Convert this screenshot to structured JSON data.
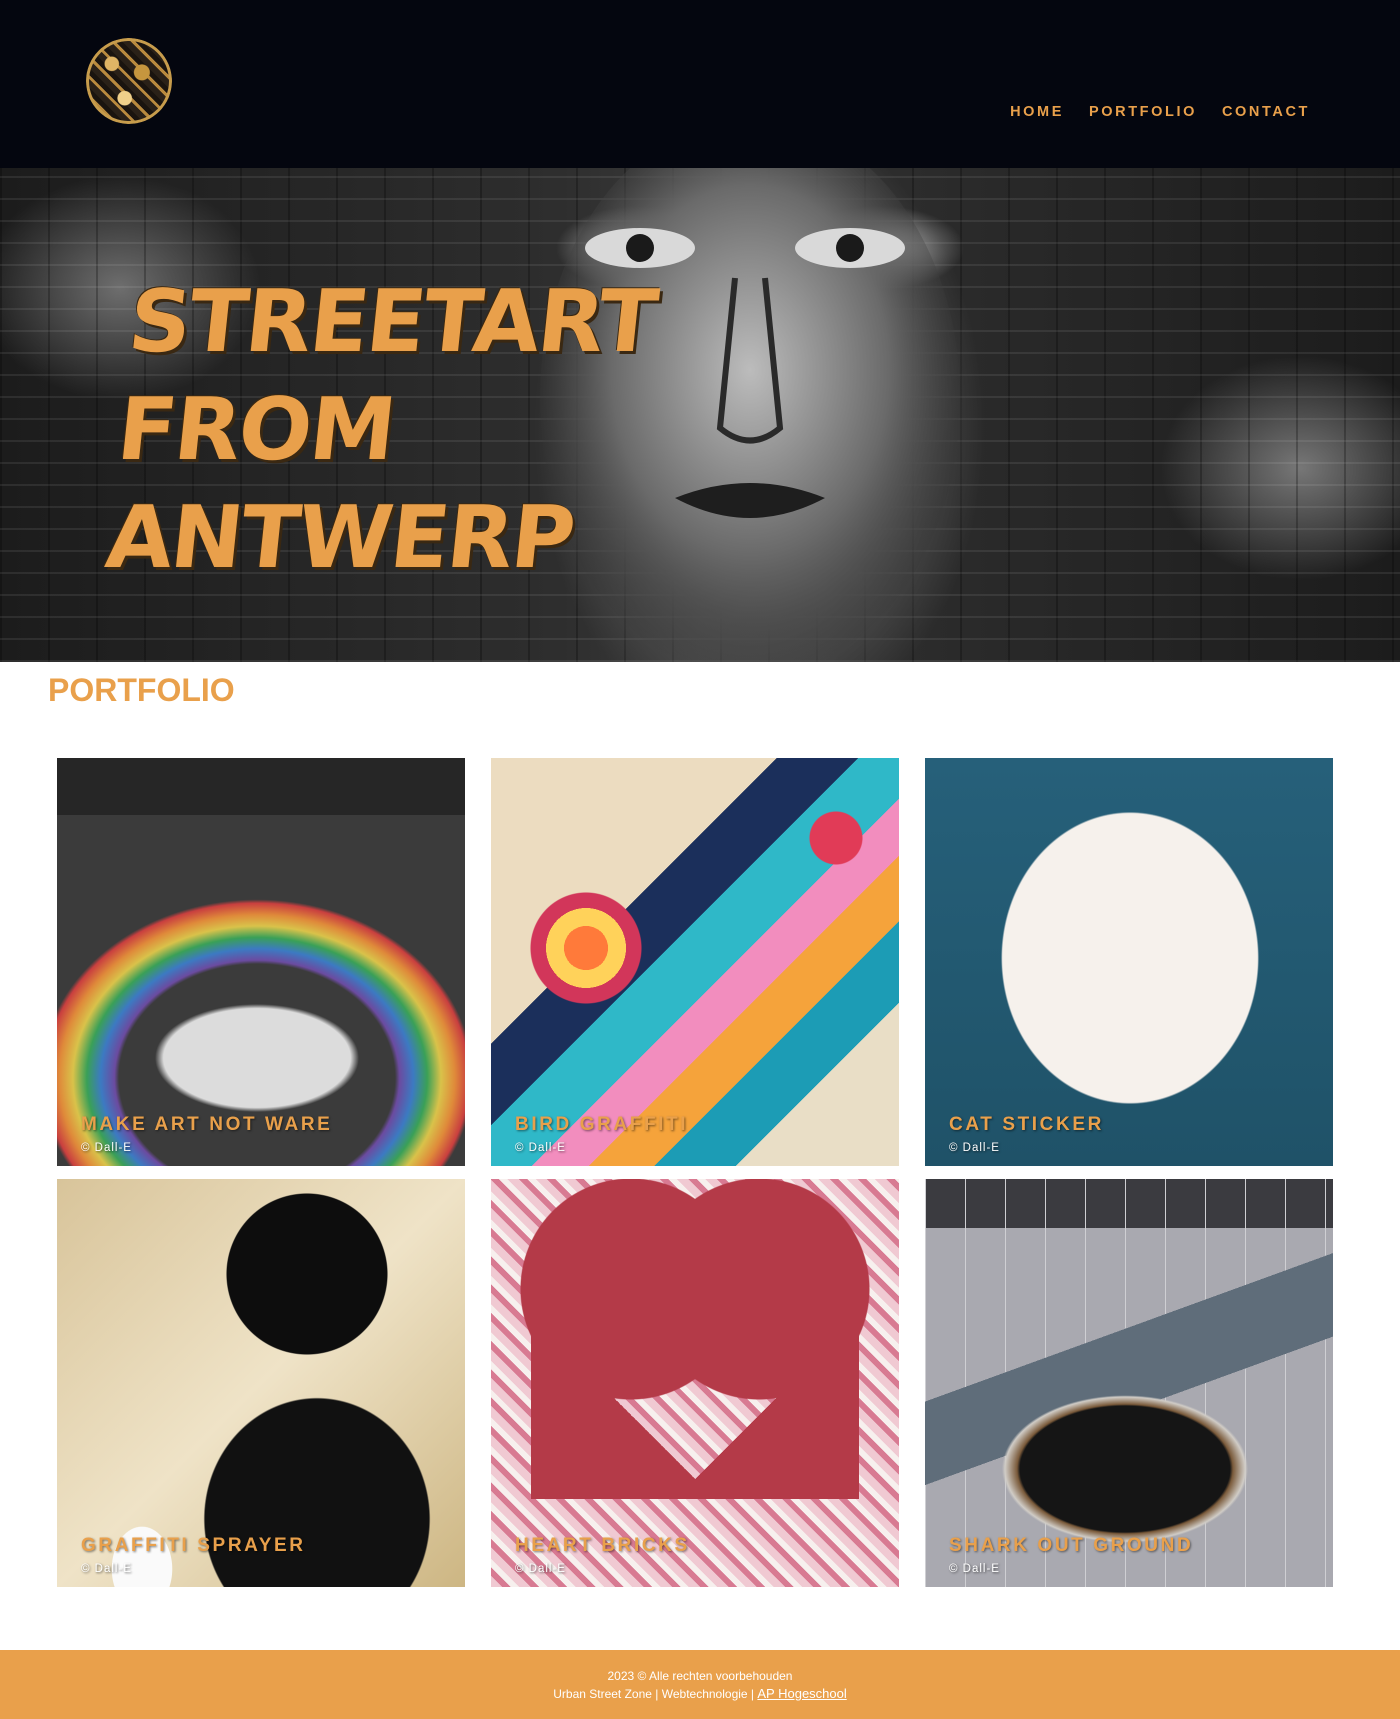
{
  "header": {
    "logo_alt": "Urban Street Zone logo",
    "nav": [
      {
        "label": "HOME"
      },
      {
        "label": "PORTFOLIO"
      },
      {
        "label": "CONTACT"
      }
    ]
  },
  "hero": {
    "title_lines": [
      "STREETART",
      "FROM",
      "ANTWERP"
    ]
  },
  "portfolio": {
    "heading": "PORTFOLIO",
    "items": [
      {
        "title": "MAKE ART NOT WARE",
        "credit": "© Dall-E"
      },
      {
        "title": "BIRD GRAFFITI",
        "credit": "© Dall-E"
      },
      {
        "title": "CAT STICKER",
        "credit": "© Dall-E"
      },
      {
        "title": "GRAFFITI SPRAYER",
        "credit": "© Dall-E"
      },
      {
        "title": "HEART BRICKS",
        "credit": "© Dall-E"
      },
      {
        "title": "SHARK OUT GROUND",
        "credit": "© Dall-E"
      }
    ]
  },
  "footer": {
    "line1": "2023 © Alle rechten voorbehouden",
    "line2_prefix": "Urban Street Zone | Webtechnologie |",
    "link": "AP Hogeschool"
  },
  "colors": {
    "accent": "#e9a04b",
    "header_bg": "#04060f",
    "footer_bg": "#e9a04b"
  }
}
